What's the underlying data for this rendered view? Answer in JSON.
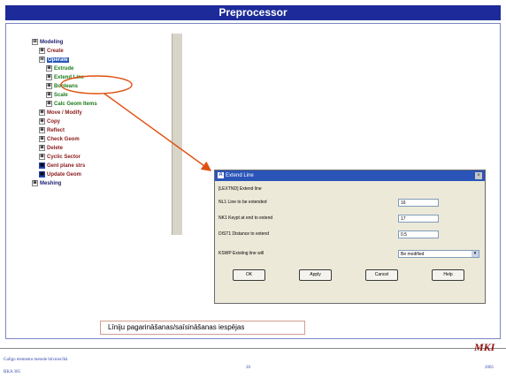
{
  "slide": {
    "title": "Preprocessor",
    "callout_text": "Līniju pagarināšanas/saīsināšanas iespējas",
    "footer_left_line1": "Galīgo elementu metode būvniecībā",
    "footer_left_line2": "BKA 305",
    "page_number": "20",
    "year": "2005",
    "logo_text": "MKI"
  },
  "tree": {
    "items": [
      {
        "label": "Modeling",
        "marker": "⊟"
      },
      {
        "label": "Create",
        "marker": "⊞"
      },
      {
        "label": "Operate",
        "marker": "⊟"
      },
      {
        "label": "Extrude",
        "marker": "⊞"
      },
      {
        "label": "Extend Line",
        "marker": "⊞"
      },
      {
        "label": "Booleans",
        "marker": "⊞"
      },
      {
        "label": "Scale",
        "marker": "⊞"
      },
      {
        "label": "Calc Geom Items",
        "marker": "⊞"
      },
      {
        "label": "Move / Modify",
        "marker": "⊞"
      },
      {
        "label": "Copy",
        "marker": "⊞"
      },
      {
        "label": "Reflect",
        "marker": "⊞"
      },
      {
        "label": "Check Geom",
        "marker": "⊞"
      },
      {
        "label": "Delete",
        "marker": "⊞"
      },
      {
        "label": "Cyclic Sector",
        "marker": "⊞"
      },
      {
        "label": "Genl plane strs",
        "marker": "▣"
      },
      {
        "label": "Update Geom",
        "marker": "▣"
      },
      {
        "label": "Meshing",
        "marker": "⊞"
      }
    ]
  },
  "dialog": {
    "title": "Extend Line",
    "close_glyph": "×",
    "command": "[LEXTND] Extend line",
    "fields": [
      {
        "label": "NL1  Line to be extended",
        "value": "16"
      },
      {
        "label": "NK1  Keypt at end to extend",
        "value": "17"
      },
      {
        "label": "DIST1  Distance to extend",
        "value": "0.5"
      }
    ],
    "select_label": "KSWP  Existing line will",
    "select_value": "Be modified",
    "select_arrow": "▾",
    "buttons": [
      "OK",
      "Apply",
      "Cancel",
      "Help"
    ]
  },
  "colors": {
    "title_bar": "#1c2b99",
    "highlight": "#2456b8",
    "annotation": "#e05010",
    "dialog_title": "#2a54b8"
  }
}
